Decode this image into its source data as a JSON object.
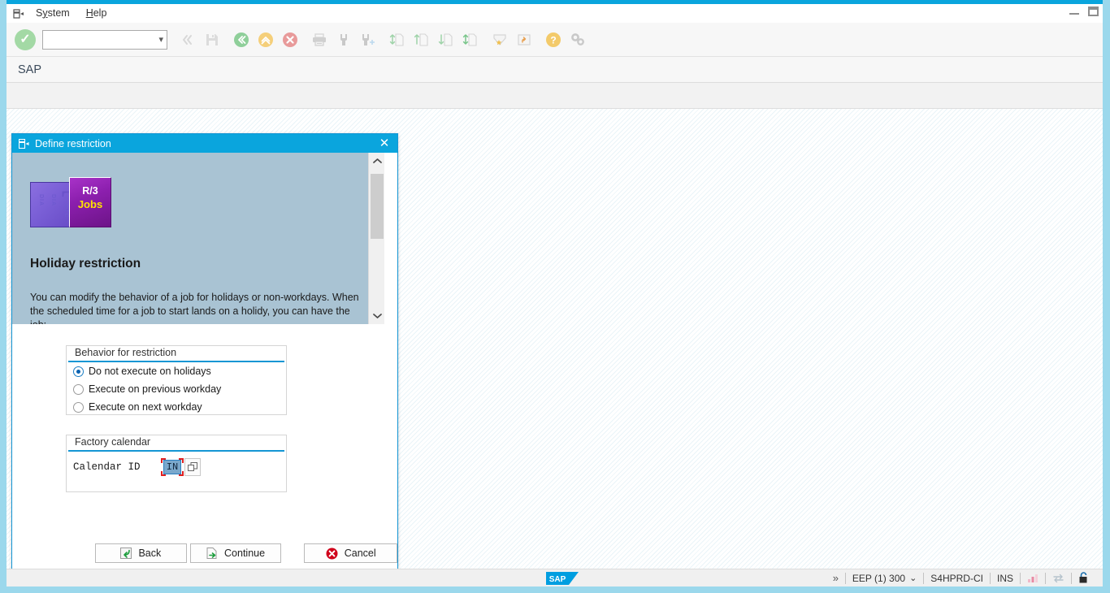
{
  "window": {
    "minimize_label": "Minimize",
    "maximize_label": "Maximize"
  },
  "menubar": {
    "system_icon": "system-menu-icon",
    "items": [
      {
        "prefix": "S",
        "accel": "y",
        "suffix": "stem",
        "label": "System"
      },
      {
        "prefix": "",
        "accel": "H",
        "suffix": "elp",
        "label": "Help"
      }
    ]
  },
  "toolbar": {
    "enter_label": "Enter",
    "command_value": "",
    "command_placeholder": "",
    "icons": [
      {
        "name": "back-chevrons-icon",
        "title": "Back"
      },
      {
        "name": "save-icon",
        "title": "Save"
      },
      {
        "name": "back-green-icon",
        "title": "Back"
      },
      {
        "name": "exit-yellow-icon",
        "title": "Exit"
      },
      {
        "name": "cancel-red-icon",
        "title": "Cancel"
      },
      {
        "name": "print-icon",
        "title": "Print"
      },
      {
        "name": "find-icon",
        "title": "Find"
      },
      {
        "name": "find-next-icon",
        "title": "Find Next"
      },
      {
        "name": "first-page-icon",
        "title": "First Page"
      },
      {
        "name": "previous-page-icon",
        "title": "Previous Page"
      },
      {
        "name": "next-page-icon",
        "title": "Next Page"
      },
      {
        "name": "last-page-icon",
        "title": "Last Page"
      },
      {
        "name": "create-favorite-icon",
        "title": "Create Favorite"
      },
      {
        "name": "new-session-icon",
        "title": "New Session"
      },
      {
        "name": "help-icon",
        "title": "Help"
      },
      {
        "name": "customize-icon",
        "title": "Customize Local Layout"
      }
    ]
  },
  "header": {
    "title": "SAP"
  },
  "dialog": {
    "title": "Define restriction",
    "title_icon": "dialog-window-icon",
    "close_label": "✕",
    "help": {
      "image_back_labels": [
        "DIA",
        "DIA",
        "BTC"
      ],
      "image_front_line1": "R/3",
      "image_front_line2": "Jobs",
      "heading": "Holiday restriction",
      "paragraph": "You can modify the behavior of a job for holidays or non-workdays. When the scheduled time for a job to start lands on a holidy, you can have the job:",
      "scroll_up": "⌃",
      "scroll_down": "⌄"
    },
    "behavior_group": {
      "legend": "Behavior for restriction",
      "options": [
        {
          "label": "Do not execute on holidays",
          "selected": true
        },
        {
          "label": "Execute on previous workday",
          "selected": false
        },
        {
          "label": "Execute on next workday",
          "selected": false
        }
      ]
    },
    "calendar_group": {
      "legend": "Factory calendar",
      "field_label": "Calendar ID",
      "field_value": "IN",
      "f4_label": "search-help"
    },
    "buttons": {
      "back": "Back",
      "continue": "Continue",
      "cancel": "Cancel"
    }
  },
  "statusbar": {
    "logo": "SAP",
    "expand_label": "»",
    "system": "EEP (1) 300",
    "system_chevron": "⌄",
    "server": "S4HPRD-CI",
    "insert_mode": "INS",
    "signal_icon": "signal-icon",
    "transfer_icon": "data-transfer-icon",
    "lock_icon": "unlocked-icon"
  },
  "colors": {
    "accent": "#0aa5dd",
    "dialog_border": "#1596d4",
    "help_bg": "#a9c3d3",
    "group_underline": "#1596d4",
    "focus_red": "#e02020",
    "field_selected": "#7aa8cc"
  }
}
